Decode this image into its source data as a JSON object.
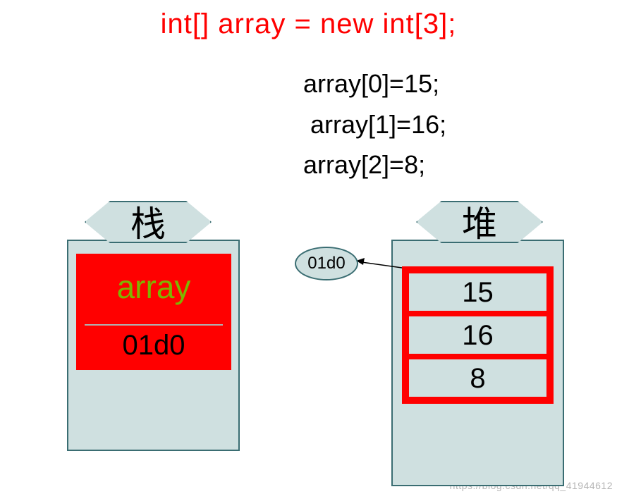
{
  "title": "int[]  array  =  new  int[3];",
  "assignments": {
    "l0": "array[0]=15;",
    "l1": " array[1]=16;",
    "l2": "array[2]=8;"
  },
  "stack": {
    "label": "栈",
    "var_name": "array",
    "var_addr": "01d0"
  },
  "heap": {
    "label": "堆",
    "cells": {
      "c0": "15",
      "c1": "16",
      "c2": "8"
    }
  },
  "pointer_addr": "01d0",
  "watermark": "https://blog.csdn.net/qq_41944612"
}
